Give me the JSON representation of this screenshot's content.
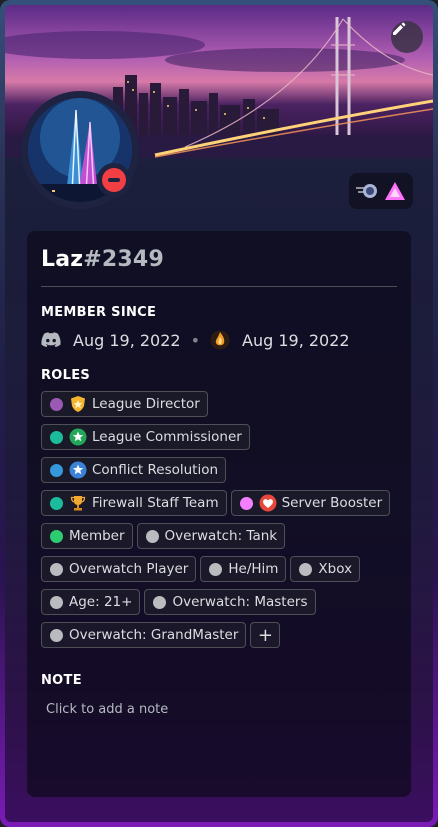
{
  "profile": {
    "username": "Laz",
    "discriminator": "#2349"
  },
  "sections": {
    "member_since": "MEMBER SINCE",
    "roles": "ROLES",
    "note": "NOTE"
  },
  "member_since": {
    "discord_date": "Aug 19, 2022",
    "server_date": "Aug 19, 2022"
  },
  "roles": [
    {
      "label": "League Director",
      "color": "#9b59b6",
      "icon": "shield-icon"
    },
    {
      "label": "League Commissioner",
      "color": "#1abc9c",
      "icon": "star-badge-icon"
    },
    {
      "label": "Conflict Resolution",
      "color": "#3498db",
      "icon": "star-badge-icon"
    },
    {
      "label": "Firewall Staff Team",
      "color": "#1abc9c",
      "icon": "trophy-icon"
    },
    {
      "label": "Server Booster",
      "color": "#f47fff",
      "icon": "heart-icon"
    },
    {
      "label": "Member",
      "color": "#2ecc71",
      "icon": ""
    },
    {
      "label": "Overwatch: Tank",
      "color": "#b9bbbe",
      "icon": ""
    },
    {
      "label": "Overwatch Player",
      "color": "#b9bbbe",
      "icon": ""
    },
    {
      "label": "He/Him",
      "color": "#b9bbbe",
      "icon": ""
    },
    {
      "label": "Xbox",
      "color": "#b9bbbe",
      "icon": ""
    },
    {
      "label": "Age: 21+",
      "color": "#b9bbbe",
      "icon": ""
    },
    {
      "label": "Overwatch: Masters",
      "color": "#b9bbbe",
      "icon": ""
    },
    {
      "label": "Overwatch: GrandMaster",
      "color": "#b9bbbe",
      "icon": ""
    }
  ],
  "add_role_label": "+",
  "note": {
    "placeholder": "Click to add a note"
  },
  "status": "do-not-disturb",
  "colors": {
    "status_dnd": "#f23f43",
    "border_accent": "#8b1fd6"
  }
}
